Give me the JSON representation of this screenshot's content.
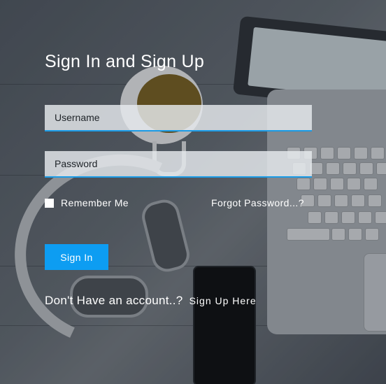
{
  "form": {
    "title": "Sign In and Sign Up",
    "username_placeholder": "Username",
    "password_placeholder": "Password",
    "remember_label": "Remember Me",
    "forgot_label": "Forgot Password...?",
    "signin_label": "Sign In",
    "account_prompt": "Don't Have an account..?",
    "signup_label": "Sign Up Here"
  },
  "colors": {
    "accent": "#0d9df2",
    "input_underline": "#1a9be6",
    "text": "#ffffff"
  }
}
